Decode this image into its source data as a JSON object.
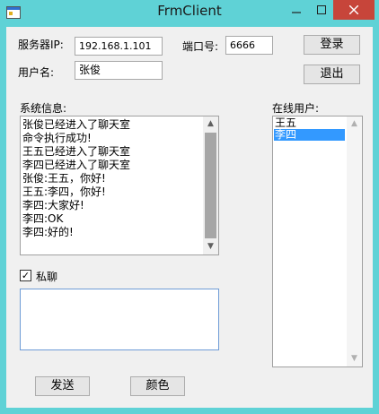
{
  "window": {
    "title": "FrmClient"
  },
  "server": {
    "ip_label": "服务器IP:",
    "ip_value": "192.168.1.101",
    "port_label": "端口号:",
    "port_value": "6666"
  },
  "user": {
    "name_label": "用户名:",
    "name_value": "张俊"
  },
  "buttons": {
    "login": "登录",
    "logout": "退出",
    "send": "发送",
    "color": "颜色"
  },
  "system": {
    "label": "系统信息:",
    "messages": [
      "张俊已经进入了聊天室",
      "命令执行成功!",
      "王五已经进入了聊天室",
      "李四已经进入了聊天室",
      "张俊:王五，你好!",
      "王五:李四，你好!",
      "李四:大家好!",
      "李四:OK",
      "李四:好的!"
    ]
  },
  "online": {
    "label": "在线用户:",
    "users": [
      "王五",
      "李四"
    ],
    "selected": "李四"
  },
  "private": {
    "label": "私聊",
    "checked": true,
    "check_mark": "✓"
  },
  "icons": {
    "minimize": "minimize-icon",
    "maximize": "maximize-icon",
    "close": "close-icon",
    "scroll_up": "chevron-up-icon",
    "scroll_down": "chevron-down-icon"
  },
  "colors": {
    "title_bar": "#5fd2d6",
    "close_button": "#c7453a",
    "selection": "#3399ff"
  }
}
